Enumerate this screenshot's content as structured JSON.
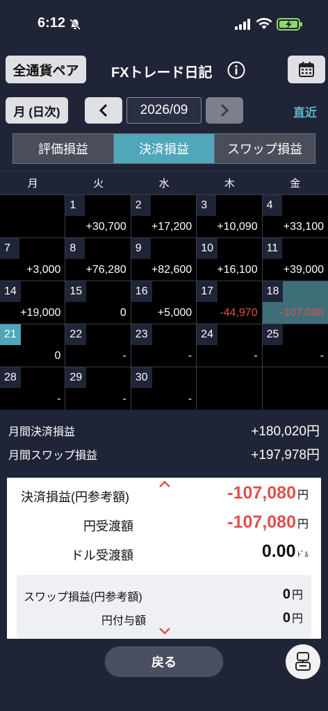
{
  "status": {
    "time": "6:12"
  },
  "header": {
    "currency_pair_label": "全通貨ペア",
    "title": "FXトレード日記",
    "unit_label": "月 (日次)",
    "month": "2026/09",
    "recent_label": "直近"
  },
  "tabs": [
    {
      "label": "評価損益",
      "active": false
    },
    {
      "label": "決済損益",
      "active": true
    },
    {
      "label": "スワップ損益",
      "active": false
    }
  ],
  "calendar": {
    "weekdays": [
      "月",
      "火",
      "水",
      "木",
      "金"
    ],
    "weeks": [
      [
        {
          "day": "",
          "amount": ""
        },
        {
          "day": "1",
          "amount": "+30,700"
        },
        {
          "day": "2",
          "amount": "+17,200"
        },
        {
          "day": "3",
          "amount": "+10,090"
        },
        {
          "day": "4",
          "amount": "+33,100"
        }
      ],
      [
        {
          "day": "7",
          "amount": "+3,000"
        },
        {
          "day": "8",
          "amount": "+76,280"
        },
        {
          "day": "9",
          "amount": "+82,600"
        },
        {
          "day": "10",
          "amount": "+16,100"
        },
        {
          "day": "11",
          "amount": "+39,000"
        }
      ],
      [
        {
          "day": "14",
          "amount": "+19,000"
        },
        {
          "day": "15",
          "amount": "0"
        },
        {
          "day": "16",
          "amount": "+5,000"
        },
        {
          "day": "17",
          "amount": "-44,970"
        },
        {
          "day": "18",
          "amount": "-107,080"
        }
      ],
      [
        {
          "day": "21",
          "amount": "0"
        },
        {
          "day": "22",
          "amount": "-"
        },
        {
          "day": "23",
          "amount": "-"
        },
        {
          "day": "24",
          "amount": "-"
        },
        {
          "day": "25",
          "amount": "-"
        }
      ],
      [
        {
          "day": "28",
          "amount": "-"
        },
        {
          "day": "29",
          "amount": "-"
        },
        {
          "day": "30",
          "amount": "-"
        },
        {
          "day": "",
          "amount": ""
        },
        {
          "day": "",
          "amount": ""
        }
      ]
    ],
    "today_day": "21",
    "selected_day": "18"
  },
  "summary": {
    "settlement_label": "月間決済損益",
    "settlement_value": "+180,020円",
    "swap_label": "月間スワップ損益",
    "swap_value": "+197,978円"
  },
  "detail": {
    "pl_label": "決済損益(円参考額)",
    "pl_value": "-107,080",
    "pl_unit": "円",
    "jpy_label": "円受渡額",
    "jpy_value": "-107,080",
    "jpy_unit": "円",
    "usd_label": "ドル受渡額",
    "usd_value": "0.00",
    "usd_unit": "ﾄﾞﾙ",
    "swap_pl_label": "スワップ損益(円参考額)",
    "swap_pl_value": "0",
    "swap_pl_unit": "円",
    "jpy_grant_label": "円付与額",
    "jpy_grant_value": "0",
    "jpy_grant_unit": "円"
  },
  "bottom": {
    "back_label": "戻る"
  },
  "colors": {
    "accent": "#4fa7b9",
    "negative": "#e0504a",
    "background": "#1f2436"
  }
}
